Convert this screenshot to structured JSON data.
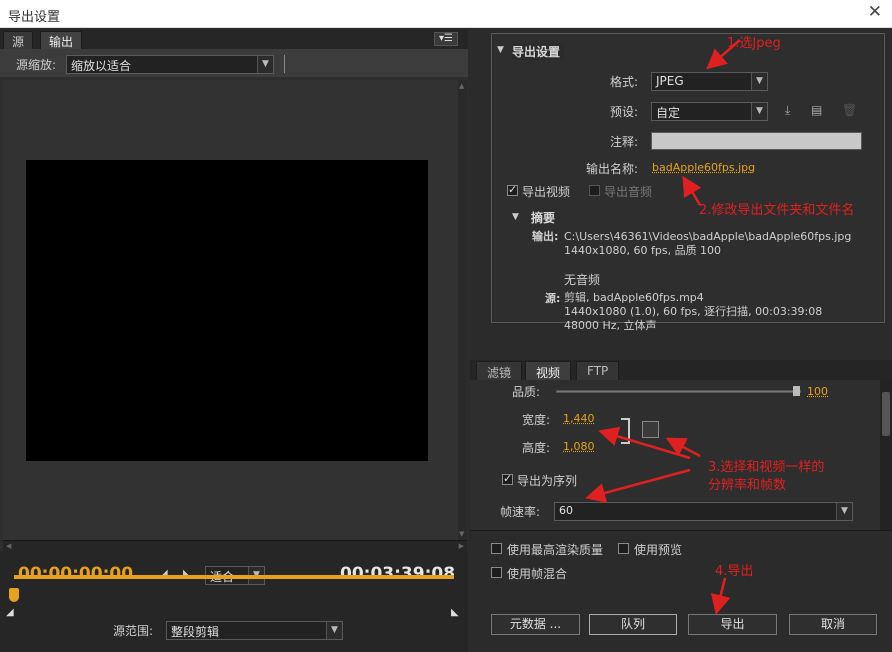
{
  "window": {
    "title": "导出设置",
    "close_symbol": "✕"
  },
  "left": {
    "tabs": [
      "源",
      "输出"
    ],
    "menu_symbol": "▾☰",
    "source_zoom_label": "源缩放:",
    "source_zoom_value": "缩放以适合",
    "timecode_current": "00:00:00:00",
    "timecode_total": "00:03:39:08",
    "fit_value": "适合",
    "source_range_label": "源范围:",
    "source_range_value": "整段剪辑"
  },
  "export_settings": {
    "title": "导出设置",
    "format_label": "格式:",
    "format_value": "JPEG",
    "preset_label": "预设:",
    "preset_value": "自定",
    "comment_label": "注释:",
    "comment_value": "",
    "output_name_label": "输出名称:",
    "output_name_value": "badApple60fps.jpg",
    "export_video_label": "导出视频",
    "export_audio_label": "导出音频",
    "export_video_checked": true,
    "export_audio_checked": false
  },
  "summary": {
    "title": "摘要",
    "output_label": "输出:",
    "output_path": "C:\\Users\\46361\\Videos\\badApple\\badApple60fps.jpg",
    "output_info": "1440x1080, 60 fps, 品质  100",
    "no_audio": "无音频",
    "source_label": "源:",
    "source_line1": "剪辑,  badApple60fps.mp4",
    "source_line2": "1440x1080 (1.0), 60 fps, 逐行扫描, 00:03:39:08",
    "source_line3": "48000 Hz, 立体声"
  },
  "video_tabs": [
    "滤镜",
    "视频",
    "FTP"
  ],
  "video": {
    "quality_label": "品质:",
    "quality_value": "100",
    "quality_fraction": 1.0,
    "width_label": "宽度:",
    "width_value": "1,440",
    "height_label": "高度:",
    "height_value": "1,080",
    "export_sequence_label": "导出为序列",
    "export_sequence_checked": true,
    "framerate_label": "帧速率:",
    "framerate_value": "60"
  },
  "options": {
    "max_render_label": "使用最高渲染质量",
    "use_preview_label": "使用预览",
    "frame_blend_label": "使用帧混合"
  },
  "buttons": {
    "metadata": "元数据 ...",
    "queue": "队列",
    "export": "导出",
    "cancel": "取消"
  },
  "annotations": {
    "a1": "1.选Jpeg",
    "a2": "2.修改导出文件夹和文件名",
    "a3_line1": "3.选择和视频一样的",
    "a3_line2": "分辨率和帧数",
    "a4": "4.导出"
  },
  "colors": {
    "accent": "#e6a21e",
    "annotation": "#e02020"
  }
}
